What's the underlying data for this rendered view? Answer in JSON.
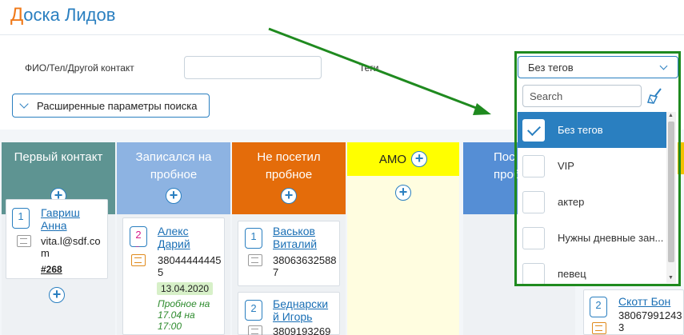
{
  "header": {
    "title_first": "Д",
    "title_rest": "оска Лидов"
  },
  "filters": {
    "contact_label": "ФИО/Тел/Другой контакт",
    "contact_value": "",
    "tags_label": "Теги",
    "advanced_label": "Расширенные параметры поиска"
  },
  "columns": [
    {
      "title_line1": "Первый контакт",
      "title_line2": "",
      "color": "#5e9492"
    },
    {
      "title_line1": "Записался на",
      "title_line2": "пробное",
      "color": "#8db3e2"
    },
    {
      "title_line1": "Не посетил",
      "title_line2": "пробное",
      "color": "#e46c0a"
    },
    {
      "title_line1": "АМО",
      "title_line2": "",
      "color": "#ffff00"
    },
    {
      "title_line1": "Пос",
      "title_line2": "проб",
      "color": "#558ed5"
    }
  ],
  "cards": [
    {
      "count": "1",
      "name_line1": "Гавриш",
      "name_line2": "Анна",
      "contact": "vita.l@sdf.com",
      "id": "#268"
    },
    {
      "count": "2",
      "name_line1": "Алекс",
      "name_line2": "Дарий",
      "contact": "380444444455",
      "date": "13.04.2020",
      "note": "Пробное на 17.04 на 17:00"
    },
    {
      "count": "1",
      "name_line1": "Васьков",
      "name_line2": "Виталий",
      "contact": "380636325887"
    },
    {
      "count": "2",
      "name_line1": "Беднарски",
      "name_line2": "й Игорь",
      "contact": "3809193269"
    },
    {
      "count": "2",
      "name_line1": "Скотт Бон",
      "name_line2": "",
      "contact": "380679912433"
    }
  ],
  "tags_dropdown": {
    "selected": "Без тегов",
    "search_placeholder": "Search",
    "options": [
      {
        "label": "Без тегов",
        "checked": true
      },
      {
        "label": "VIP",
        "checked": false
      },
      {
        "label": "актер",
        "checked": false
      },
      {
        "label": "Нужны дневные зан...",
        "checked": false
      },
      {
        "label": "певец",
        "checked": false
      }
    ]
  },
  "colors": {
    "accent": "#2a7fc0",
    "highlight_border": "#1f8a1f",
    "arrow": "#1f8a1f"
  }
}
